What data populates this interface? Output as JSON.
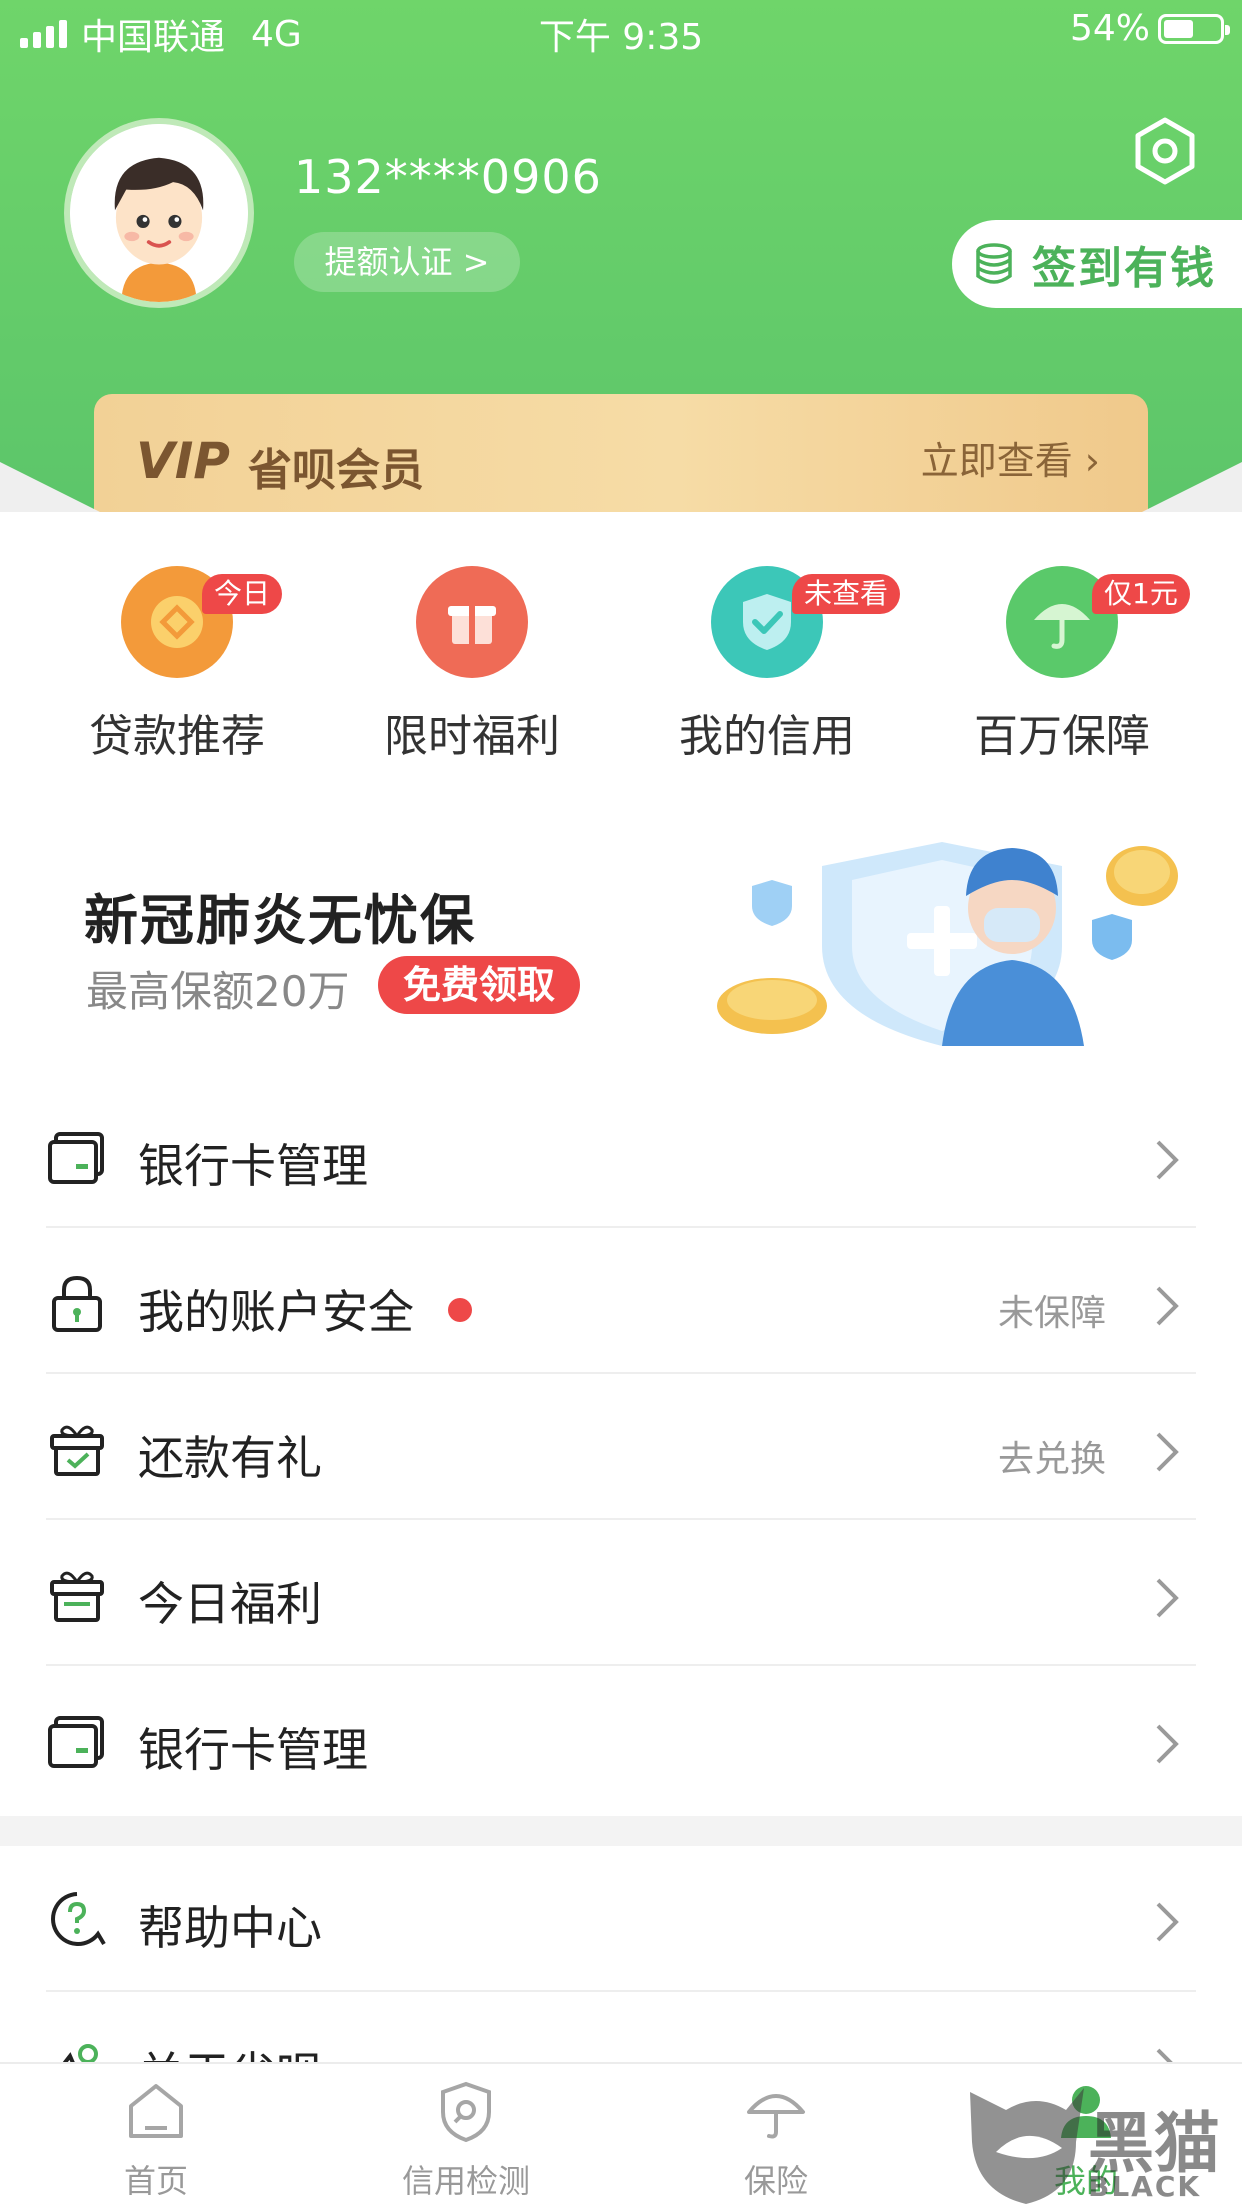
{
  "status_bar": {
    "carrier": "中国联通",
    "network": "4G",
    "time": "下午 9:35",
    "battery": "54%",
    "battery_level": 0.54
  },
  "profile": {
    "phone": "132****0906",
    "cert_label": "提额认证 >",
    "sign_label": "签到有钱",
    "settings_icon": "hexagon-gear-icon",
    "avatar_icon": "cartoon-boy-avatar"
  },
  "vip": {
    "logo": "VIP",
    "name": "省呗会员",
    "action": "立即查看 ›"
  },
  "quick_links": [
    {
      "label": "贷款推荐",
      "badge": "今日",
      "icon": "diamond-coin-icon",
      "color": "#f39a3a"
    },
    {
      "label": "限时福利",
      "badge": "",
      "icon": "gift-box-icon",
      "color": "#ef6b56"
    },
    {
      "label": "我的信用",
      "badge": "未查看",
      "icon": "shield-check-icon",
      "color": "#3cc7b8"
    },
    {
      "label": "百万保障",
      "badge": "仅1元",
      "icon": "umbrella-icon",
      "color": "#5ac96a"
    }
  ],
  "banner": {
    "title": "新冠肺炎无忧保",
    "subtitle": "最高保额20万",
    "button": "免费领取"
  },
  "menu": [
    {
      "label": "银行卡管理",
      "status": "",
      "icon": "bank-card-icon"
    },
    {
      "label": "我的账户安全",
      "status": "未保障",
      "icon": "lock-icon",
      "dot": true
    },
    {
      "label": "还款有礼",
      "status": "去兑换",
      "icon": "gift-check-icon"
    },
    {
      "label": "今日福利",
      "status": "",
      "icon": "gift-icon"
    },
    {
      "label": "银行卡管理",
      "status": "",
      "icon": "bank-card-icon"
    }
  ],
  "menu2": [
    {
      "label": "帮助中心",
      "status": "",
      "icon": "help-icon"
    },
    {
      "label": "关于省呗",
      "status": "",
      "icon": "about-icon"
    }
  ],
  "tabs": [
    {
      "label": "首页",
      "icon": "home-icon"
    },
    {
      "label": "信用检测",
      "icon": "shield-search-icon"
    },
    {
      "label": "保险",
      "icon": "umbrella-icon"
    },
    {
      "label": "我的",
      "icon": "profile-icon"
    }
  ],
  "watermark": {
    "text": "黑猫",
    "sub": "BLACK CAT"
  },
  "colors": {
    "header_green": "#6fd56a",
    "accent_green": "#4cb25a",
    "badge_red": "#ee4848",
    "vip_gold": "#f2d196"
  }
}
